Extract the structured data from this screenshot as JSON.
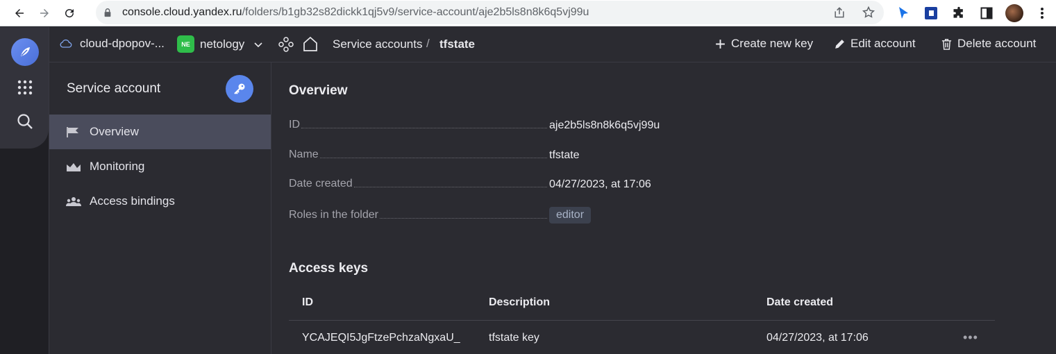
{
  "browser": {
    "url_host": "console.cloud.yandex.ru",
    "url_path": "/folders/b1gb32s82dickk1qj5v9/service-account/aje2b5ls8n8k6q5vj99u"
  },
  "appbar": {
    "cloud": "cloud-dpopov-...",
    "folder_badge": "NE",
    "folder": "netology",
    "breadcrumb_section": "Service accounts",
    "breadcrumb_sep": "/",
    "breadcrumb_current": "tfstate",
    "actions": {
      "create_key": "Create new key",
      "edit": "Edit account",
      "delete": "Delete account"
    }
  },
  "sidebar": {
    "title": "Service account",
    "items": [
      {
        "label": "Overview",
        "icon": "flag-icon",
        "active": true
      },
      {
        "label": "Monitoring",
        "icon": "chart-icon",
        "active": false
      },
      {
        "label": "Access bindings",
        "icon": "people-icon",
        "active": false
      }
    ]
  },
  "overview": {
    "title": "Overview",
    "fields": [
      {
        "key": "ID",
        "value": "aje2b5ls8n8k6q5vj99u"
      },
      {
        "key": "Name",
        "value": "tfstate"
      },
      {
        "key": "Date created",
        "value": "04/27/2023, at 17:06"
      },
      {
        "key": "Roles in the folder",
        "value": "editor"
      }
    ]
  },
  "access_keys": {
    "title": "Access keys",
    "columns": [
      "ID",
      "Description",
      "Date created"
    ],
    "rows": [
      {
        "id": "YCAJEQI5JgFtzePchzaNgxaU_",
        "description": "tfstate key",
        "date": "04/27/2023, at 17:06",
        "menu": "•••"
      }
    ]
  }
}
